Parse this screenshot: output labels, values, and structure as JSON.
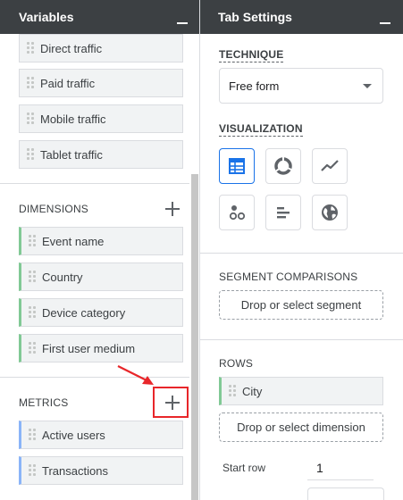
{
  "variables_panel": {
    "title": "Variables",
    "segments": [
      "Direct traffic",
      "Paid traffic",
      "Mobile traffic",
      "Tablet traffic"
    ],
    "dimensions_label": "DIMENSIONS",
    "dimensions": [
      "Event name",
      "Country",
      "Device category",
      "First user medium"
    ],
    "metrics_label": "METRICS",
    "metrics": [
      "Active users",
      "Transactions"
    ]
  },
  "tab_settings": {
    "title": "Tab Settings",
    "technique_label": "TECHNIQUE",
    "technique_value": "Free form",
    "visualization_label": "VISUALIZATION",
    "visualizations": [
      "table-icon",
      "donut-chart-icon",
      "line-chart-icon",
      "scatter-plot-icon",
      "bar-chart-icon",
      "globe-icon"
    ],
    "segment_comparisons_label": "SEGMENT COMPARISONS",
    "segment_drop_label": "Drop or select segment",
    "rows_label": "ROWS",
    "rows": [
      "City"
    ],
    "dimension_drop_label": "Drop or select dimension",
    "start_row_label": "Start row",
    "start_row_value": "1"
  },
  "colors": {
    "header_bg": "#3c4043",
    "dimension_accent": "#81c995",
    "metric_accent": "#8ab4f8",
    "active_blue": "#1a73e8",
    "annotation_red": "#e8262a"
  }
}
